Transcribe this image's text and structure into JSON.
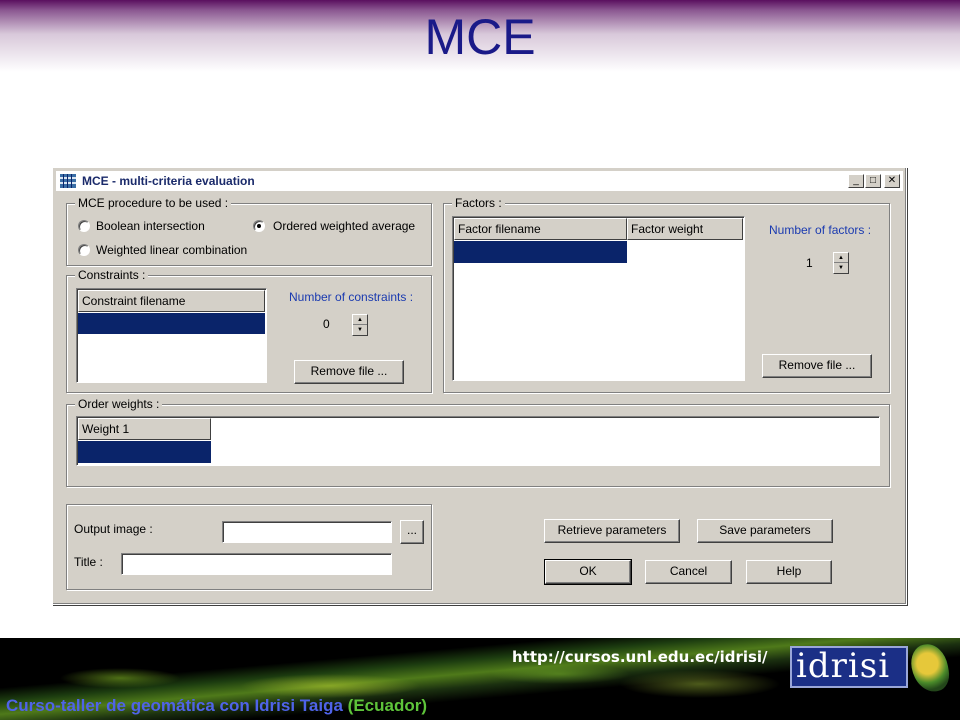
{
  "slide": {
    "title": "MCE",
    "url": "http://cursos.unl.edu.ec/idrisi/",
    "footer_main": "Curso-taller de geomática con Idrisi Taiga",
    "footer_region": "(Ecuador)",
    "logo_text": "idrisi"
  },
  "window": {
    "title": "MCE - multi-criteria evaluation",
    "minimize_glyph": "_",
    "maximize_glyph": "□",
    "close_glyph": "✕"
  },
  "procedure": {
    "legend": "MCE procedure to be used :",
    "options": [
      {
        "label": "Boolean intersection",
        "selected": false
      },
      {
        "label": "Ordered weighted average",
        "selected": true
      },
      {
        "label": "Weighted linear combination",
        "selected": false
      }
    ]
  },
  "constraints": {
    "legend": "Constraints :",
    "column": "Constraint filename",
    "count_label": "Number of constraints :",
    "count": "0",
    "remove_label": "Remove file ..."
  },
  "factors": {
    "legend": "Factors :",
    "columns": [
      "Factor filename",
      "Factor weight"
    ],
    "count_label": "Number of factors :",
    "count": "1",
    "remove_label": "Remove file ..."
  },
  "order_weights": {
    "legend": "Order weights :",
    "column": "Weight 1"
  },
  "output": {
    "image_label": "Output image :",
    "image_value": "",
    "browse_label": "...",
    "title_label": "Title :",
    "title_value": ""
  },
  "actions": {
    "retrieve": "Retrieve parameters",
    "save": "Save parameters",
    "ok": "OK",
    "cancel": "Cancel",
    "help": "Help"
  },
  "colors": {
    "title_blue": "#1a1a88",
    "selection": "#0a246a",
    "dialog_face": "#d4d0c8",
    "label_blue": "#1a3ab0",
    "footer_blue": "#4f63e8",
    "footer_green": "#5ec43a"
  }
}
